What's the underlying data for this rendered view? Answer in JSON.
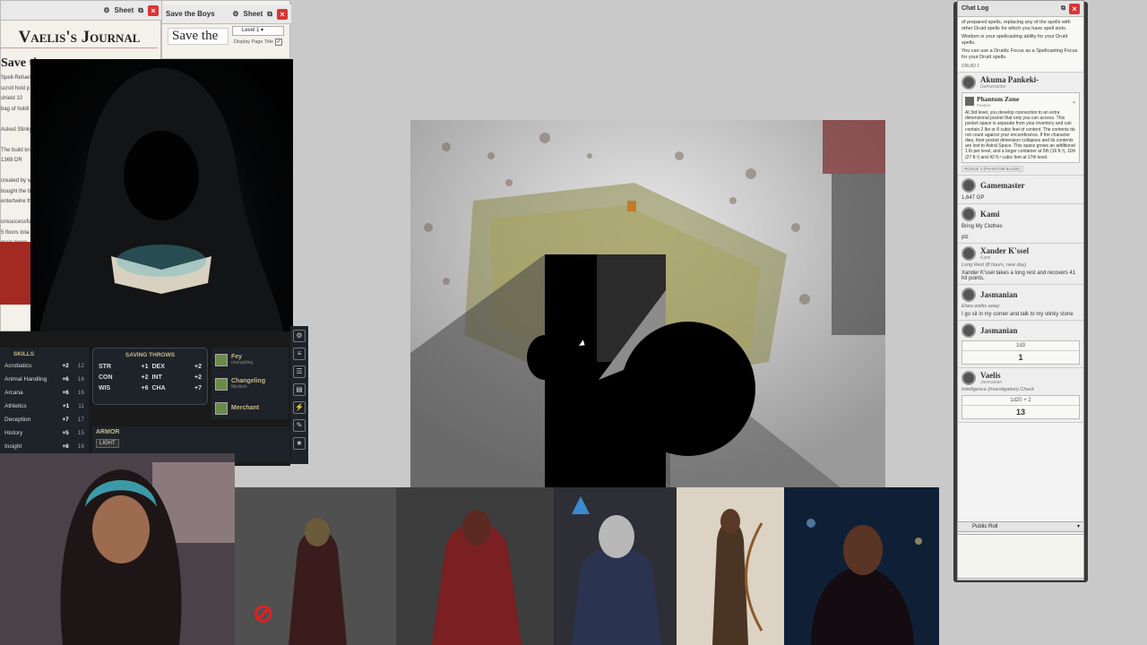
{
  "journal_window": {
    "sheet_label": "Sheet",
    "title": "Vaelis's Journal",
    "heading": "Save the",
    "notes": [
      "Spell-Refuel",
      "scroll hold p",
      "shield 10",
      "bag of holdi",
      "",
      "Asked Stinky",
      "",
      "The build kn",
      "1368 DR",
      "",
      "created by w",
      "bought the b",
      "entertwine th",
      "",
      "unsuccessful",
      "5 floors tota",
      "main tower",
      "construction",
      "haunted by d"
    ]
  },
  "handout_window": {
    "title": "Save the Boys",
    "sheet_label": "Sheet",
    "heading_preview": "Save the",
    "level_select": "Level 1",
    "display_page_title_label": "Display Page Title"
  },
  "skills": {
    "header": "SKILLS",
    "rows": [
      {
        "name": "Acrobatics",
        "mod": "+2",
        "score": "12"
      },
      {
        "name": "Animal Handling",
        "mod": "+6",
        "score": "16"
      },
      {
        "name": "Arcana",
        "mod": "+6",
        "score": "16"
      },
      {
        "name": "Athletics",
        "mod": "+1",
        "score": "11"
      },
      {
        "name": "Deception",
        "mod": "+7",
        "score": "17"
      },
      {
        "name": "History",
        "mod": "+5",
        "score": "15"
      },
      {
        "name": "Insight",
        "mod": "+6",
        "score": "16"
      }
    ]
  },
  "saving_throws": {
    "header": "SAVING THROWS",
    "rows": [
      {
        "ab": "STR",
        "mod": "+1"
      },
      {
        "ab": "DEX",
        "mod": "+2"
      },
      {
        "ab": "CON",
        "mod": "+2"
      },
      {
        "ab": "INT",
        "mod": "+2"
      },
      {
        "ab": "WIS",
        "mod": "+6"
      },
      {
        "ab": "CHA",
        "mod": "+7"
      }
    ]
  },
  "features": [
    {
      "name": "Fey",
      "sub": "changeling"
    },
    {
      "name": "Changeling",
      "sub": "Medium"
    },
    {
      "name": "Merchant",
      "sub": ""
    }
  ],
  "armor": {
    "header": "ARMOR",
    "tag": "LIGHT"
  },
  "chat": {
    "title": "Chat Log",
    "intro_text": "of prepared spells, replacing any of the spells with other Druid spells for which you have spell slots.",
    "intro_ability": "Wisdom is your spellcasting ability for your Druid spells.",
    "intro_focus": "You can use a Druidic Focus as a Spellcasting Focus for your Druid spells.",
    "intro_tag": "DRUID 1",
    "messages": [
      {
        "who": "Akuma Pankeki-",
        "sub": "Gamemaster",
        "card_title": "Phantom Zone",
        "card_sub": "Feature",
        "card_text": "At 3rd level, you develop connection to an extra dimensional pocket that only you can access. This pocket space is separate from your inventory and can contain 2 lbs or 8 cubic feet of content. The contents do not count against your encumbrance. If the character dies, their pocket dimension collapses and its contents are lost to Astral Space. This space grows an additional 1 lb per level, and a larger container at 5th (16 ft.³), 11th (27 ft.³) and 42 ft.³ cubic feet at 17th level.",
        "tag": "ROGUE 3 (PHANTOM BLADE)"
      },
      {
        "who": "Gamemaster",
        "text": "1,647 GP"
      },
      {
        "who": "Kami",
        "text": "Bring My Clothes",
        "text2": "plz"
      },
      {
        "who": "Xander K'ssel",
        "sub": "Kami",
        "italic": "Long Rest (8 hours, new day)",
        "text": "Xander K'ssel takes a long rest and recovers 41 hit points."
      },
      {
        "who": "Jasmanian",
        "italic": "Elara walks away",
        "text": "I go sit in my corner and talk to my stinky stone"
      },
      {
        "who": "Jasmanian",
        "formula": "1d3",
        "result": "1"
      },
      {
        "who": "Vaelis",
        "sub": "Jasmanian",
        "italic": "Intelligence (Investigation) Check",
        "formula": "1d20 + 2",
        "result": "13"
      }
    ],
    "roll_mode": "Public Roll"
  },
  "icons": [
    "close-icon",
    "popout-icon",
    "gear-icon",
    "chevron-down-icon",
    "muted-mic-icon"
  ]
}
